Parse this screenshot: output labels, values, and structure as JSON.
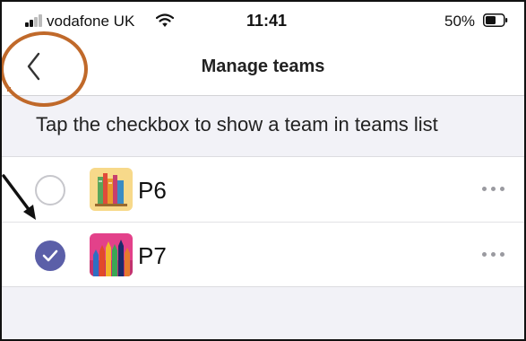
{
  "status_bar": {
    "carrier": "vodafone UK",
    "time": "11:41",
    "battery_percent": "50%",
    "icons": [
      "signal-icon",
      "wifi-icon",
      "battery-icon"
    ]
  },
  "nav": {
    "title": "Manage teams",
    "back_icon": "chevron-left-icon"
  },
  "instruction": "Tap the checkbox to show a team in teams list",
  "teams": [
    {
      "name": "P6",
      "checked": false,
      "icon": "books-icon",
      "icon_bg": "#f7d98a"
    },
    {
      "name": "P7",
      "checked": true,
      "icon": "pencils-icon",
      "icon_bg": "#e3418a"
    }
  ],
  "colors": {
    "accent": "#5b5fa8",
    "highlight": "#c0692a"
  }
}
